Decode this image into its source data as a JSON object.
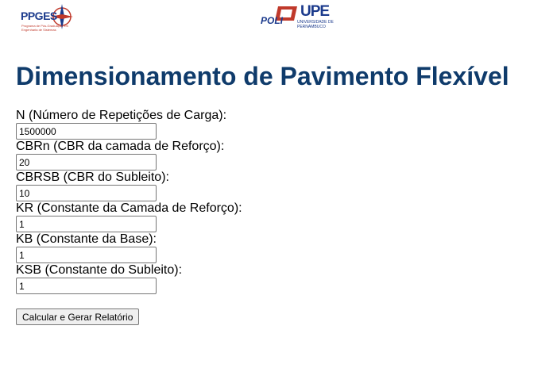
{
  "header": {
    "logo_left_text": "PPGES",
    "logo_left_subtitle": "Programa de Pós-Graduação em Engenharia de Sistemas",
    "logo_right_poli": "POLI",
    "logo_right_upe": "UPE",
    "logo_right_university": "UNIVERSIDADE DE PERNAMBUCO"
  },
  "page": {
    "title": "Dimensionamento de Pavimento Flexível"
  },
  "form": {
    "fields": [
      {
        "label": "N (Número de Repetições de Carga):",
        "value": "1500000"
      },
      {
        "label": "CBRn (CBR da camada de Reforço):",
        "value": "20"
      },
      {
        "label": "CBRSB (CBR do Subleito):",
        "value": "10"
      },
      {
        "label": "KR (Constante da Camada de Reforço):",
        "value": "1"
      },
      {
        "label": "KB (Constante da Base):",
        "value": "1"
      },
      {
        "label": "KSB (Constante do Subleito):",
        "value": "1"
      }
    ],
    "submit_label": "Calcular e Gerar Relatório"
  }
}
